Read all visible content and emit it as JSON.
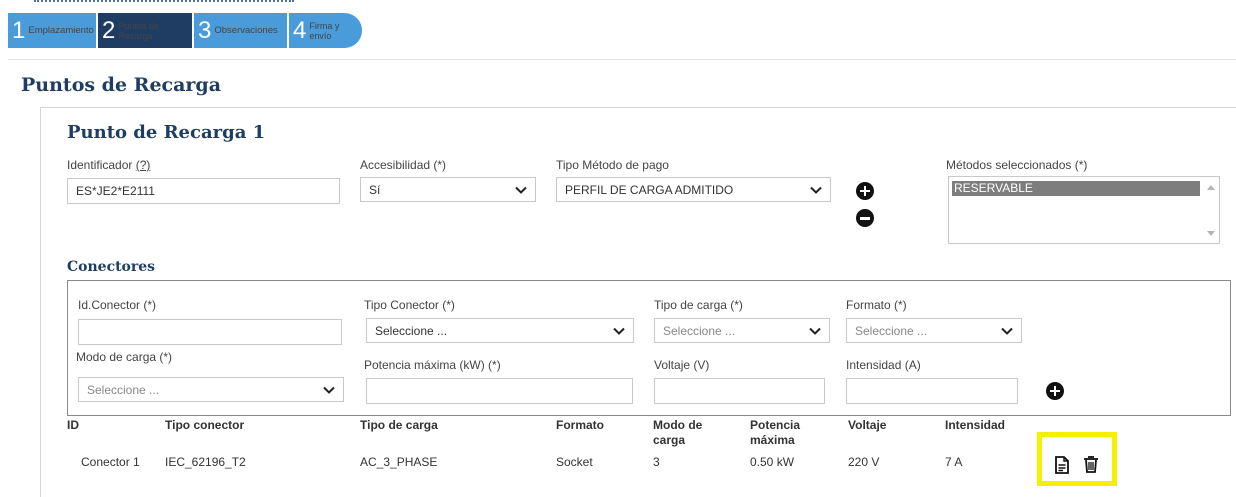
{
  "wizard": {
    "steps": [
      {
        "num": "1",
        "label": "Emplazamiento"
      },
      {
        "num": "2",
        "label_line1": "Puntos de",
        "label_line2": "Recarga"
      },
      {
        "num": "3",
        "label": "Observaciones"
      },
      {
        "num": "4",
        "label_line1": "Firma y",
        "label_line2": "envío"
      }
    ],
    "active_index": 1
  },
  "page_title": "Puntos de Recarga",
  "punto": {
    "title": "Punto de Recarga 1",
    "identificador": {
      "label": "Identificador",
      "help": "(?)",
      "value": "ES*JE2*E2111"
    },
    "accesibilidad": {
      "label": "Accesibilidad (*)",
      "value": "Sí"
    },
    "tipo_metodo_pago": {
      "label": "Tipo Método de pago",
      "value": "PERFIL DE CARGA ADMITIDO"
    },
    "metodos_seleccionados": {
      "label": "Métodos seleccionados (*)",
      "options": [
        "RESERVABLE"
      ]
    }
  },
  "conectores": {
    "title": "Conectores",
    "form": {
      "id_conector": {
        "label": "Id.Conector (*)",
        "value": ""
      },
      "tipo_conector": {
        "label": "Tipo Conector (*)",
        "value": "Seleccione ..."
      },
      "tipo_carga": {
        "label": "Tipo de carga (*)",
        "value": "Seleccione ..."
      },
      "formato": {
        "label": "Formato (*)",
        "value": "Seleccione ..."
      },
      "modo_carga": {
        "label": "Modo de carga (*)",
        "value": "Seleccione ..."
      },
      "potencia": {
        "label": "Potencia máxima (kW) (*)",
        "value": ""
      },
      "voltaje": {
        "label": "Voltaje (V)",
        "value": ""
      },
      "intensidad": {
        "label": "Intensidad (A)",
        "value": ""
      }
    },
    "table": {
      "headers": {
        "id": "ID",
        "tipo_conector": "Tipo conector",
        "tipo_carga": "Tipo de carga",
        "formato": "Formato",
        "modo_l1": "Modo de",
        "modo_l2": "carga",
        "potencia_l1": "Potencia",
        "potencia_l2": "máxima",
        "voltaje": "Voltaje",
        "intensidad": "Intensidad"
      },
      "rows": [
        {
          "id": "Conector 1",
          "tipo_conector": "IEC_62196_T2",
          "tipo_carga": "AC_3_PHASE",
          "formato": "Socket",
          "modo": "3",
          "potencia": "0.50 kW",
          "voltaje": "220 V",
          "intensidad": "7 A"
        }
      ]
    }
  },
  "icons": {
    "add": "plus-circle-icon",
    "remove": "minus-circle-icon",
    "edit": "document-icon",
    "delete": "trash-icon",
    "dropdown": "chevron-down-icon"
  },
  "colors": {
    "step_active": "#1f3d63",
    "step_inactive": "#4a9bd9",
    "title": "#1f3d63",
    "highlight": "#f5f000",
    "selected_option": "#7d7d7d"
  }
}
